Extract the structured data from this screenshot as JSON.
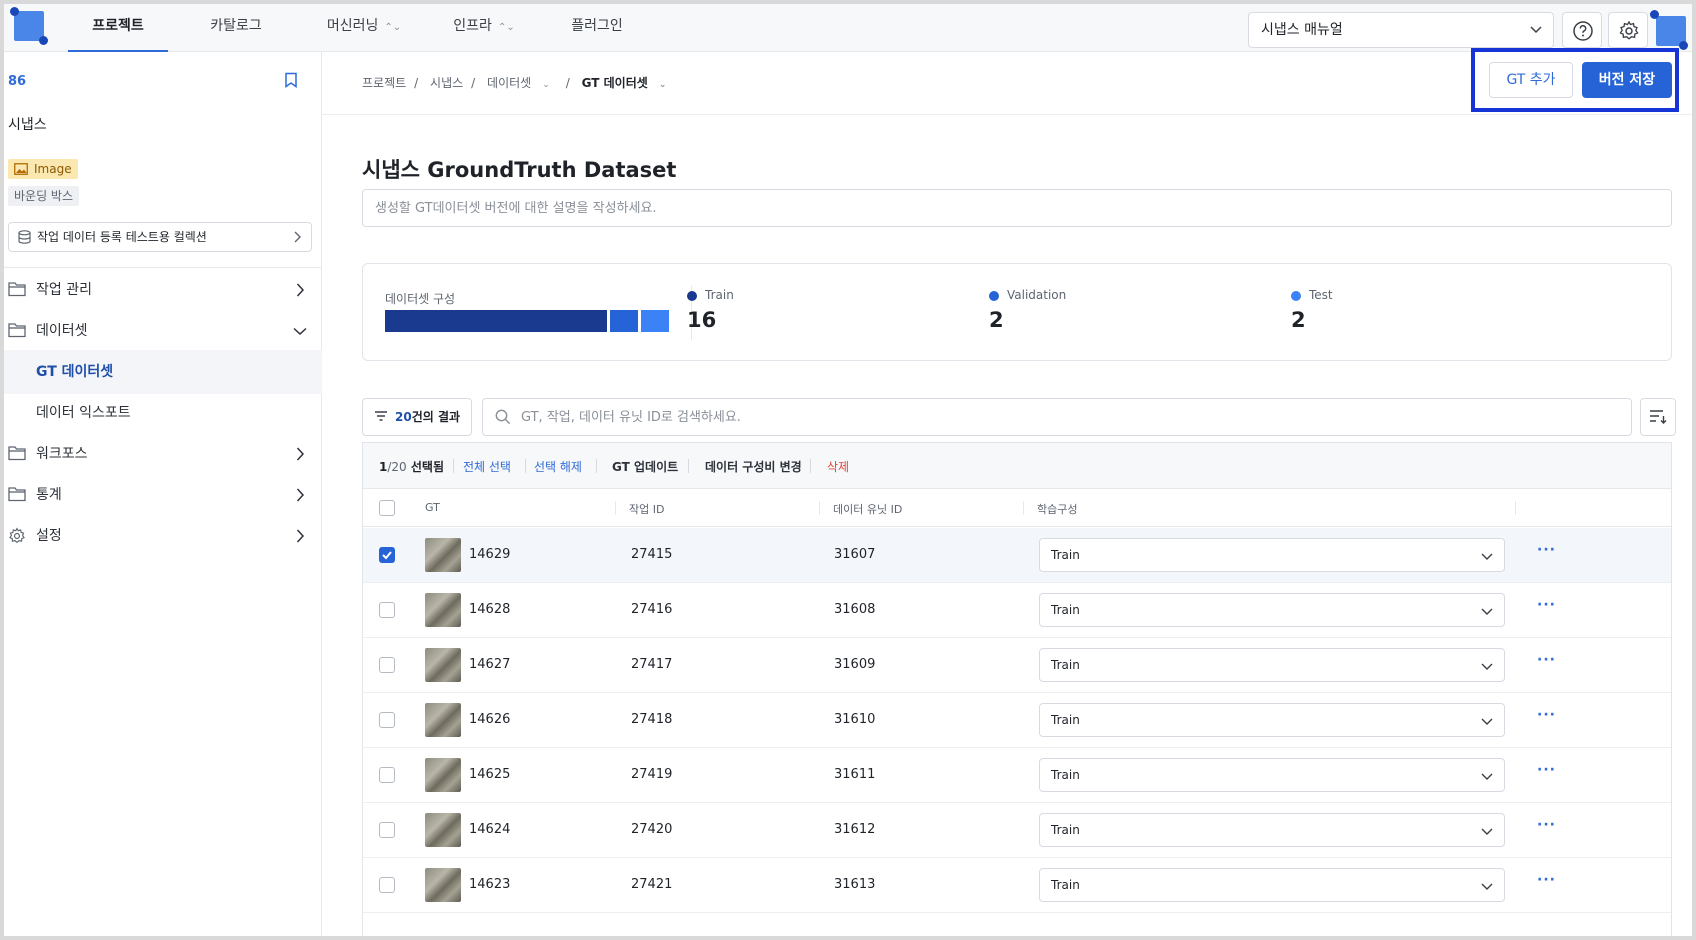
{
  "topnav": {
    "tabs": [
      {
        "label": "프로젝트",
        "has_chevron": false,
        "active": true
      },
      {
        "label": "카탈로그",
        "has_chevron": false,
        "active": false
      },
      {
        "label": "머신러닝",
        "has_chevron": true,
        "active": false
      },
      {
        "label": "인프라",
        "has_chevron": true,
        "active": false
      },
      {
        "label": "플러그인",
        "has_chevron": false,
        "active": false
      }
    ],
    "manual_select": "시냅스 매뉴얼",
    "help_icon": "help-circle-icon",
    "settings_icon": "gear-icon"
  },
  "sidebar": {
    "project_id": "86",
    "project_name": "시냅스",
    "data_type_badge": "Image",
    "annotation_badge": "바운딩 박스",
    "collection": "작업 데이터 등록 테스트용 컬렉션",
    "menu": {
      "job_management": "작업 관리",
      "datasets": "데이터셋",
      "gt_datasets": "GT 데이터셋",
      "data_export": "데이터 익스포트",
      "workforce": "워크포스",
      "stats": "통계",
      "settings": "설정"
    }
  },
  "breadcrumb": {
    "items": [
      "프로젝트",
      "시냅스",
      "데이터셋",
      "GT 데이터셋"
    ],
    "separator": "/"
  },
  "actions": {
    "gt_add": "GT 추가",
    "save_version": "버전 저장"
  },
  "page": {
    "title": "시냅스 GroundTruth Dataset",
    "description_placeholder": "생성할 GT데이터셋 버전에 대한 설명을 작성하세요."
  },
  "split": {
    "label": "데이터셋 구성",
    "items": [
      {
        "name": "Train",
        "count": "16",
        "color": "#1a3a8f"
      },
      {
        "name": "Validation",
        "count": "2",
        "color": "#2563d6"
      },
      {
        "name": "Test",
        "count": "2",
        "color": "#3b82f6"
      }
    ]
  },
  "filter": {
    "result_count": "20",
    "result_suffix": "건의 결과",
    "search_placeholder": "GT, 작업, 데이터 유닛 ID로 검색하세요."
  },
  "toolbar": {
    "selected": "1",
    "total": "/20",
    "selected_suffix": "선택됨",
    "select_all": "전체 선택",
    "deselect": "선택 해제",
    "gt_update": "GT 업데이트",
    "change_ratio": "데이터 구성비 변경",
    "delete": "삭제"
  },
  "table": {
    "headers": {
      "gt": "GT",
      "job_id": "작업 ID",
      "unit_id": "데이터 유닛 ID",
      "split": "학습구성"
    },
    "rows": [
      {
        "gt": "14629",
        "job_id": "27415",
        "unit_id": "31607",
        "split": "Train",
        "checked": true
      },
      {
        "gt": "14628",
        "job_id": "27416",
        "unit_id": "31608",
        "split": "Train",
        "checked": false
      },
      {
        "gt": "14627",
        "job_id": "27417",
        "unit_id": "31609",
        "split": "Train",
        "checked": false
      },
      {
        "gt": "14626",
        "job_id": "27418",
        "unit_id": "31610",
        "split": "Train",
        "checked": false
      },
      {
        "gt": "14625",
        "job_id": "27419",
        "unit_id": "31611",
        "split": "Train",
        "checked": false
      },
      {
        "gt": "14624",
        "job_id": "27420",
        "unit_id": "31612",
        "split": "Train",
        "checked": false
      },
      {
        "gt": "14623",
        "job_id": "27421",
        "unit_id": "31613",
        "split": "Train",
        "checked": false
      }
    ],
    "more_label": "···"
  }
}
